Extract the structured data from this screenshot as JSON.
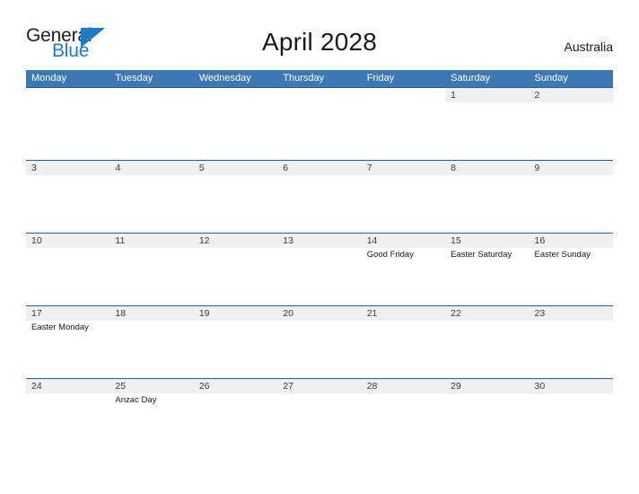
{
  "brand": {
    "name_part1": "General",
    "name_part2": "Blue",
    "triangle_icon": "blue-triangle-flag",
    "color_dark": "#231f20",
    "color_blue": "#1f7cc4"
  },
  "header": {
    "title": "April 2028",
    "country": "Australia"
  },
  "theme": {
    "header_blue": "#3c78b5",
    "rule_blue": "#2e5f8f",
    "band_gray": "#f0f0f0"
  },
  "calendar": {
    "weekdays": [
      "Monday",
      "Tuesday",
      "Wednesday",
      "Thursday",
      "Friday",
      "Saturday",
      "Sunday"
    ],
    "weeks": [
      [
        {
          "date": "",
          "event": ""
        },
        {
          "date": "",
          "event": ""
        },
        {
          "date": "",
          "event": ""
        },
        {
          "date": "",
          "event": ""
        },
        {
          "date": "",
          "event": ""
        },
        {
          "date": "1",
          "event": ""
        },
        {
          "date": "2",
          "event": ""
        }
      ],
      [
        {
          "date": "3",
          "event": ""
        },
        {
          "date": "4",
          "event": ""
        },
        {
          "date": "5",
          "event": ""
        },
        {
          "date": "6",
          "event": ""
        },
        {
          "date": "7",
          "event": ""
        },
        {
          "date": "8",
          "event": ""
        },
        {
          "date": "9",
          "event": ""
        }
      ],
      [
        {
          "date": "10",
          "event": ""
        },
        {
          "date": "11",
          "event": ""
        },
        {
          "date": "12",
          "event": ""
        },
        {
          "date": "13",
          "event": ""
        },
        {
          "date": "14",
          "event": "Good Friday"
        },
        {
          "date": "15",
          "event": "Easter Saturday"
        },
        {
          "date": "16",
          "event": "Easter Sunday"
        }
      ],
      [
        {
          "date": "17",
          "event": "Easter Monday"
        },
        {
          "date": "18",
          "event": ""
        },
        {
          "date": "19",
          "event": ""
        },
        {
          "date": "20",
          "event": ""
        },
        {
          "date": "21",
          "event": ""
        },
        {
          "date": "22",
          "event": ""
        },
        {
          "date": "23",
          "event": ""
        }
      ],
      [
        {
          "date": "24",
          "event": ""
        },
        {
          "date": "25",
          "event": "Anzac Day"
        },
        {
          "date": "26",
          "event": ""
        },
        {
          "date": "27",
          "event": ""
        },
        {
          "date": "28",
          "event": ""
        },
        {
          "date": "29",
          "event": ""
        },
        {
          "date": "30",
          "event": ""
        }
      ]
    ]
  }
}
